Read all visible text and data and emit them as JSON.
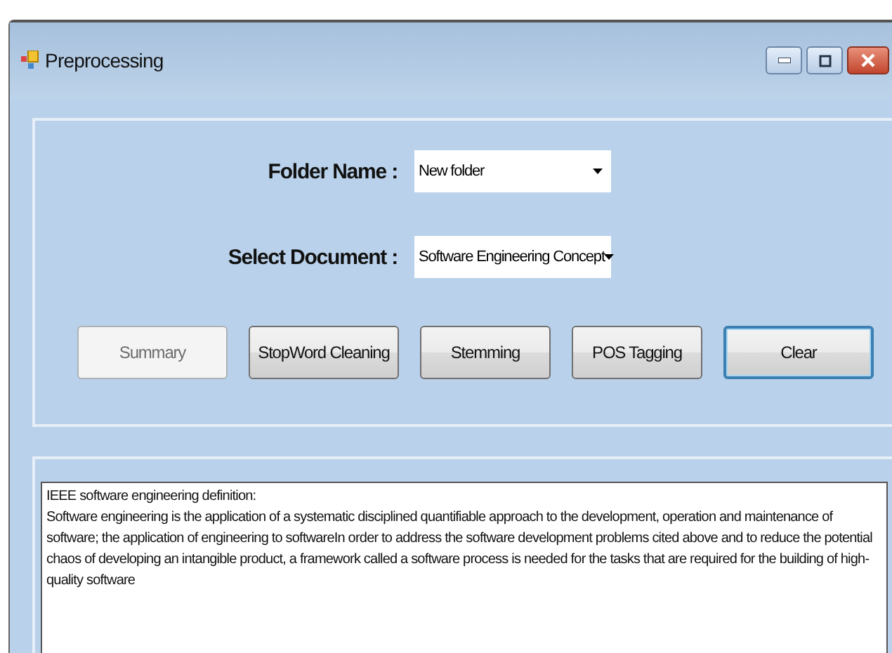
{
  "window": {
    "title": "Preprocessing"
  },
  "fields": [
    {
      "label": "Folder Name :",
      "value": "New folder"
    },
    {
      "label": "Select Document :",
      "value": "Software Engineering Concept"
    }
  ],
  "buttons": [
    {
      "label": "Summary",
      "disabled": true,
      "focused": false
    },
    {
      "label": "StopWord Cleaning",
      "disabled": false,
      "focused": false
    },
    {
      "label": "Stemming",
      "disabled": false,
      "focused": false
    },
    {
      "label": "POS Tagging",
      "disabled": false,
      "focused": false
    },
    {
      "label": "Clear",
      "disabled": false,
      "focused": true
    }
  ],
  "output": {
    "heading": "IEEE software engineering definition:",
    "text": "Software engineering is the application of a systematic disciplined quantifiable approach to the development, operation and maintenance of software; the application of engineering to softwareIn order to address the software development problems cited above and to reduce the potential chaos of developing an intangible product, a framework called a software process is needed for the tasks that are required for the building of high-quality software"
  }
}
